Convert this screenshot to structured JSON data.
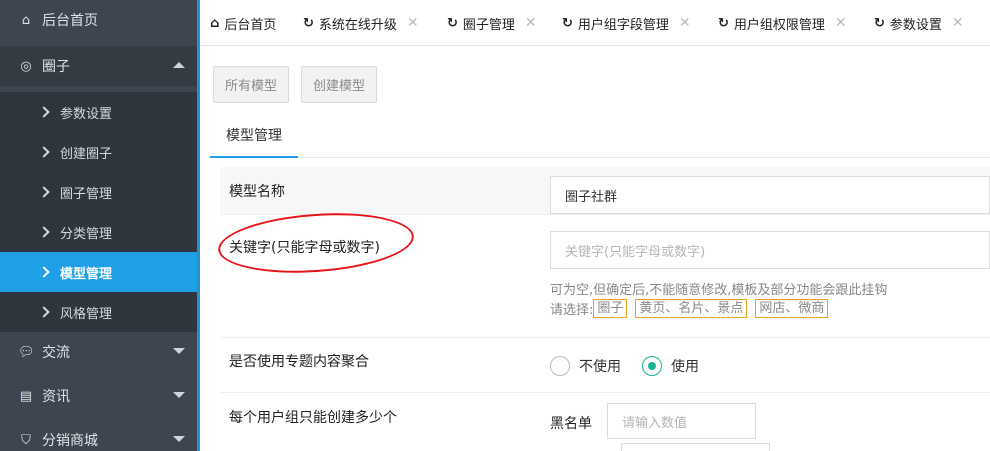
{
  "sidebar": {
    "home": "后台首页",
    "circle": "圈子",
    "circle_items": [
      "参数设置",
      "创建圈子",
      "圈子管理",
      "分类管理",
      "模型管理",
      "风格管理"
    ],
    "exchange": "交流",
    "news": "资讯",
    "shop": "分销商城"
  },
  "tabs": [
    {
      "label": "后台首页"
    },
    {
      "label": "系统在线升级"
    },
    {
      "label": "圈子管理"
    },
    {
      "label": "用户组字段管理"
    },
    {
      "label": "用户组权限管理"
    },
    {
      "label": "参数设置"
    }
  ],
  "toolbar": {
    "all_models": "所有模型",
    "create_model": "创建模型"
  },
  "subtab": {
    "label": "模型管理"
  },
  "form": {
    "model_name": {
      "label": "模型名称",
      "value": "圈子社群"
    },
    "keyword": {
      "label": "关键字(只能字母或数字)",
      "placeholder": "关键字(只能字母或数字)",
      "hint": "可为空,但确定后,不能随意修改,模板及部分功能会跟此挂钩",
      "choose_label": "请选择:",
      "options": [
        "圈子",
        "黄页、名片、景点",
        "网店、微商"
      ]
    },
    "topic": {
      "label": "是否使用专题内容聚合",
      "options": [
        "不使用",
        "使用"
      ],
      "selected": "使用"
    },
    "limit": {
      "label": "每个用户组只能创建多少个",
      "blacklist": "黑名单",
      "placeholder": "请输入数值"
    }
  }
}
